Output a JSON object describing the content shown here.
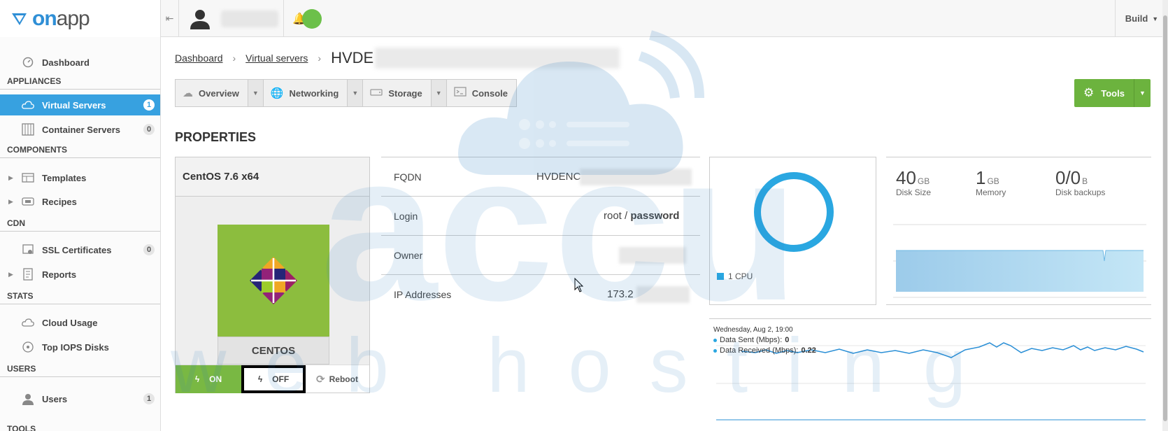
{
  "brand": {
    "name_part1": "on",
    "name_part2": "app"
  },
  "topbar": {
    "build_label": "Build"
  },
  "sidebar": {
    "dashboard": "Dashboard",
    "sections": {
      "appliances": "APPLIANCES",
      "components": "COMPONENTS",
      "cdn": "CDN",
      "stats": "STATS",
      "users": "USERS",
      "tools": "TOOLS"
    },
    "items": {
      "virtual_servers": {
        "label": "Virtual Servers",
        "count": "1"
      },
      "container_servers": {
        "label": "Container Servers",
        "count": "0"
      },
      "templates": {
        "label": "Templates"
      },
      "recipes": {
        "label": "Recipes"
      },
      "ssl_certificates": {
        "label": "SSL Certificates",
        "count": "0"
      },
      "reports": {
        "label": "Reports"
      },
      "cloud_usage": {
        "label": "Cloud Usage"
      },
      "top_iops_disks": {
        "label": "Top IOPS Disks"
      },
      "users": {
        "label": "Users",
        "count": "1"
      }
    }
  },
  "breadcrumb": {
    "dashboard": "Dashboard",
    "virtual_servers": "Virtual servers",
    "current": "HVDE"
  },
  "tabs": {
    "overview": "Overview",
    "networking": "Networking",
    "storage": "Storage",
    "console": "Console"
  },
  "tools_label": "Tools",
  "properties_title": "PROPERTIES",
  "os": {
    "title": "CentOS 7.6 x64",
    "name": "CENTOS",
    "on_label": "ON",
    "off_label": "OFF",
    "reboot_label": "Reboot"
  },
  "info": {
    "fqdn_label": "FQDN",
    "fqdn_value": "HVDENC",
    "login_label": "Login",
    "login_user": "root",
    "login_sep": " / ",
    "login_pass": "password",
    "owner_label": "Owner",
    "ip_label": "IP Addresses",
    "ip_value": "173.2"
  },
  "cpu": {
    "legend": "1 CPU"
  },
  "stats": {
    "disk_size": {
      "value": "40",
      "unit": "GB",
      "label": "Disk Size"
    },
    "memory": {
      "value": "1",
      "unit": "GB",
      "label": "Memory"
    },
    "disk_backups": {
      "value": "0/0",
      "unit": "B",
      "label": "Disk backups"
    }
  },
  "network": {
    "date": "Wednesday, Aug 2, 19:00",
    "sent_label": "Data Sent (Mbps): ",
    "sent_value": "0",
    "received_label": "Data Received (Mbps): ",
    "received_value": "0.22"
  },
  "watermark": {
    "line1": "accu",
    "line2": "web hosting"
  },
  "colors": {
    "accent_blue": "#37a1e0",
    "tools_green": "#6cb33e",
    "on_green": "#79b843",
    "centos_green": "#8cbd3e"
  }
}
